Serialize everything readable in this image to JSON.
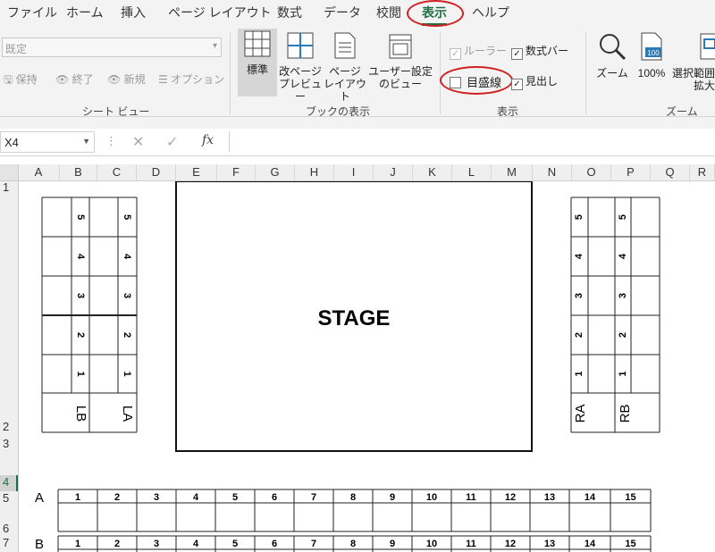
{
  "tabs": [
    "ファイル",
    "ホーム",
    "挿入",
    "ページ レイアウト",
    "数式",
    "データ",
    "校閲",
    "表示",
    "ヘルプ"
  ],
  "ribbon": {
    "sheet_view": {
      "dropdown_value": "既定",
      "keep": "保持",
      "exit": "終了",
      "new": "新規",
      "options": "オプション",
      "label": "シート ビュー"
    },
    "workbook_views": {
      "normal": "標準",
      "page_break_l1": "改ページ",
      "page_break_l2": "プレビュー",
      "page_layout_l1": "ページ",
      "page_layout_l2": "レイアウト",
      "custom_l1": "ユーザー設定",
      "custom_l2": "のビュー",
      "label": "ブックの表示"
    },
    "show": {
      "ruler": "ルーラー",
      "formula_bar": "数式バー",
      "gridlines": "目盛線",
      "headings": "見出し",
      "label": "表示"
    },
    "zoom": {
      "zoom": "ズーム",
      "hundred": "100%",
      "sel_l1": "選択範囲",
      "sel_l2": "拡大",
      "label": "ズーム",
      "icon_100": "100"
    }
  },
  "formula": {
    "name_box": "X4",
    "fx": "fx"
  },
  "columns": [
    "A",
    "B",
    "C",
    "D",
    "E",
    "F",
    "G",
    "H",
    "I",
    "J",
    "K",
    "L",
    "M",
    "N",
    "O",
    "P",
    "Q",
    "R"
  ],
  "rows": [
    "1",
    "2",
    "3",
    "4",
    "5",
    "6",
    "7"
  ],
  "sheet": {
    "stage": "STAGE",
    "left_blocks": [
      "LB",
      "LA"
    ],
    "right_blocks": [
      "RA",
      "RB"
    ],
    "block_seats": [
      "5",
      "4",
      "3",
      "2",
      "1"
    ],
    "row_labels": [
      "A",
      "B"
    ],
    "seat_numbers": [
      "1",
      "2",
      "3",
      "4",
      "5",
      "6",
      "7",
      "8",
      "9",
      "10",
      "11",
      "12",
      "13",
      "14",
      "15"
    ]
  },
  "colors": {
    "accent": "#1f6e43",
    "highlight_oval": "#d02020"
  }
}
